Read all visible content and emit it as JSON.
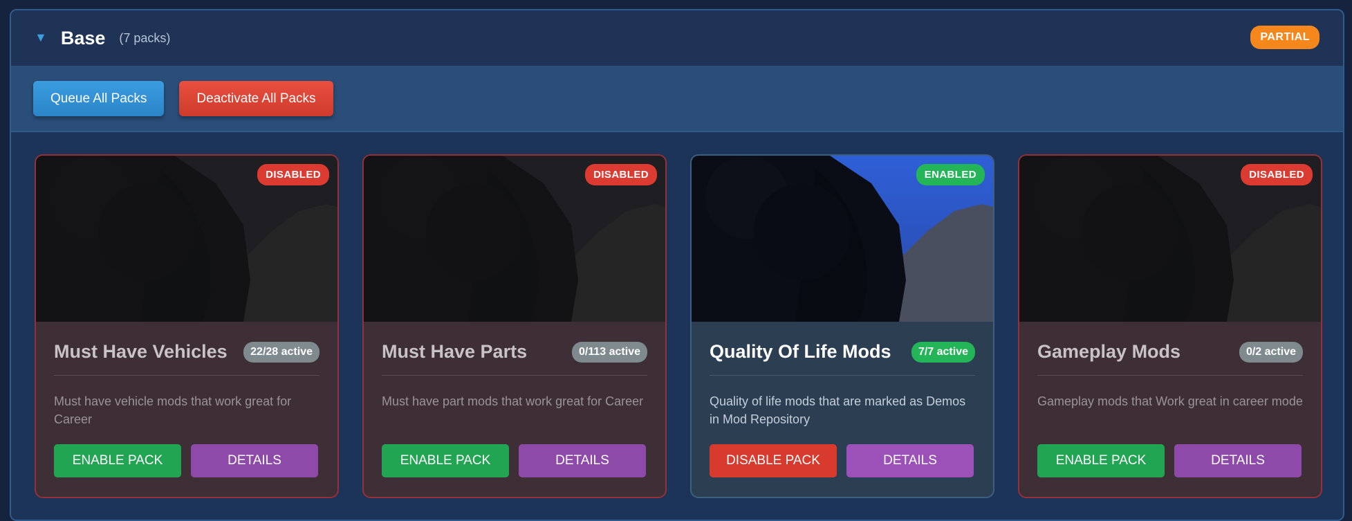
{
  "group": {
    "title": "Base",
    "count": "(7 packs)",
    "status": "PARTIAL",
    "caret_icon": "triangle-down-icon"
  },
  "toolbar": {
    "queue_label": "Queue All Packs",
    "deactivate_label": "Deactivate All Packs"
  },
  "colors": {
    "disabled": "#dc3b31",
    "enabled": "#24b558",
    "partial": "#f5871d",
    "details": "#9b51b7",
    "queue": "#2b84c8"
  },
  "packs": [
    {
      "title": "Must Have Vehicles",
      "active": "22/28 active",
      "status": "DISABLED",
      "description": "Must have vehicle mods that work great for Career",
      "primary_label": "ENABLE PACK",
      "details_label": "DETAILS"
    },
    {
      "title": "Must Have Parts",
      "active": "0/113 active",
      "status": "DISABLED",
      "description": "Must have part mods that work great for Career",
      "primary_label": "ENABLE PACK",
      "details_label": "DETAILS"
    },
    {
      "title": "Quality Of Life Mods",
      "active": "7/7 active",
      "status": "ENABLED",
      "description": "Quality of life mods that are marked as Demos in Mod Repository",
      "primary_label": "DISABLE PACK",
      "details_label": "DETAILS"
    },
    {
      "title": "Gameplay Mods",
      "active": "0/2 active",
      "status": "DISABLED",
      "description": "Gameplay mods that Work great in career mode",
      "primary_label": "ENABLE PACK",
      "details_label": "DETAILS"
    }
  ]
}
